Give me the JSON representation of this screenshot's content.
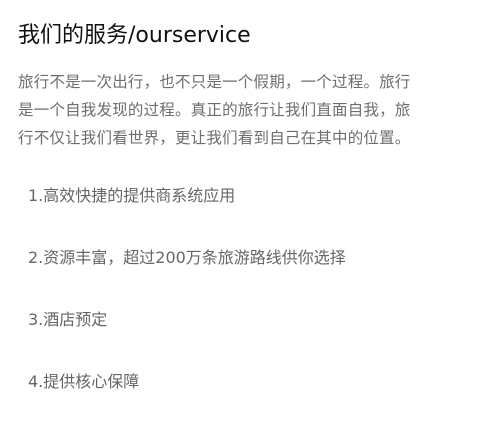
{
  "header": {
    "title": "我们的服务/ourservice"
  },
  "intro": {
    "text": "旅行不是一次出行，也不只是一个假期，一个过程。旅行是一个自我发现的过程。真正的旅行让我们直面自我，旅行不仅让我们看世界，更让我们看到自己在其中的位置。"
  },
  "services": [
    {
      "text": "1.高效快捷的提供商系统应用"
    },
    {
      "text": "2.资源丰富，超过200万条旅游路线供你选择"
    },
    {
      "text": "3.酒店预定"
    },
    {
      "text": "4.提供核心保障"
    }
  ],
  "colors": {
    "title": "#111111",
    "body_text": "#6e6e6e",
    "list_text": "#666666",
    "background": "#ffffff"
  }
}
